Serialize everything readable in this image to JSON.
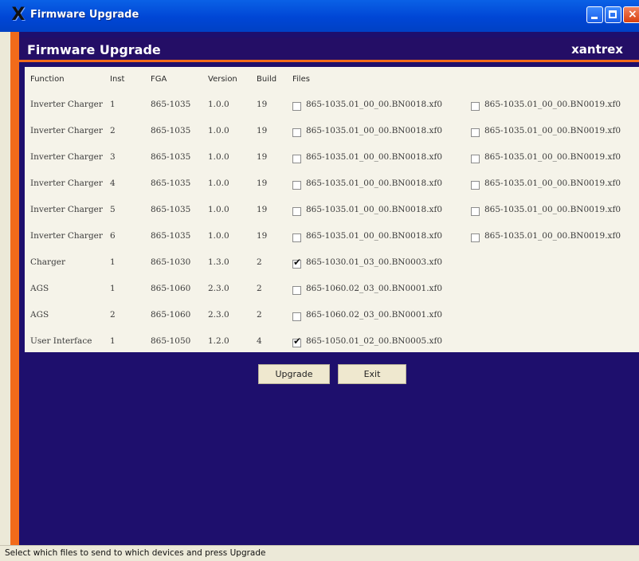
{
  "window": {
    "title": "Firmware Upgrade",
    "app_icon_glyph": "X"
  },
  "header": {
    "title": "Firmware Upgrade",
    "brand": "xantrex"
  },
  "table": {
    "columns": [
      "Function",
      "Inst",
      "FGA",
      "Version",
      "Build",
      "Files"
    ],
    "rows": [
      {
        "function": "Inverter Charger",
        "inst": "1",
        "fga": "865-1035",
        "version": "1.0.0",
        "build": "19",
        "file1": "865-1035.01_00_00.BN0018.xf0",
        "file1_checked": false,
        "file2": "865-1035.01_00_00.BN0019.xf0",
        "file2_checked": false
      },
      {
        "function": "Inverter Charger",
        "inst": "2",
        "fga": "865-1035",
        "version": "1.0.0",
        "build": "19",
        "file1": "865-1035.01_00_00.BN0018.xf0",
        "file1_checked": false,
        "file2": "865-1035.01_00_00.BN0019.xf0",
        "file2_checked": false
      },
      {
        "function": "Inverter Charger",
        "inst": "3",
        "fga": "865-1035",
        "version": "1.0.0",
        "build": "19",
        "file1": "865-1035.01_00_00.BN0018.xf0",
        "file1_checked": false,
        "file2": "865-1035.01_00_00.BN0019.xf0",
        "file2_checked": false
      },
      {
        "function": "Inverter Charger",
        "inst": "4",
        "fga": "865-1035",
        "version": "1.0.0",
        "build": "19",
        "file1": "865-1035.01_00_00.BN0018.xf0",
        "file1_checked": false,
        "file2": "865-1035.01_00_00.BN0019.xf0",
        "file2_checked": false
      },
      {
        "function": "Inverter Charger",
        "inst": "5",
        "fga": "865-1035",
        "version": "1.0.0",
        "build": "19",
        "file1": "865-1035.01_00_00.BN0018.xf0",
        "file1_checked": false,
        "file2": "865-1035.01_00_00.BN0019.xf0",
        "file2_checked": false
      },
      {
        "function": "Inverter Charger",
        "inst": "6",
        "fga": "865-1035",
        "version": "1.0.0",
        "build": "19",
        "file1": "865-1035.01_00_00.BN0018.xf0",
        "file1_checked": false,
        "file2": "865-1035.01_00_00.BN0019.xf0",
        "file2_checked": false
      },
      {
        "function": "Charger",
        "inst": "1",
        "fga": "865-1030",
        "version": "1.3.0",
        "build": "2",
        "file1": "865-1030.01_03_00.BN0003.xf0",
        "file1_checked": true
      },
      {
        "function": "AGS",
        "inst": "1",
        "fga": "865-1060",
        "version": "2.3.0",
        "build": "2",
        "file1": "865-1060.02_03_00.BN0001.xf0",
        "file1_checked": false
      },
      {
        "function": "AGS",
        "inst": "2",
        "fga": "865-1060",
        "version": "2.3.0",
        "build": "2",
        "file1": "865-1060.02_03_00.BN0001.xf0",
        "file1_checked": false
      },
      {
        "function": "User Interface",
        "inst": "1",
        "fga": "865-1050",
        "version": "1.2.0",
        "build": "4",
        "file1": "865-1050.01_02_00.BN0005.xf0",
        "file1_checked": true
      }
    ]
  },
  "buttons": {
    "upgrade": "Upgrade",
    "exit": "Exit"
  },
  "status": {
    "text": "Select which files to send to which devices and press Upgrade"
  },
  "colors": {
    "titlebar": "#0046d5",
    "background": "#1e0f6d",
    "accent": "#f26b1a",
    "panel": "#f5f3e9"
  }
}
